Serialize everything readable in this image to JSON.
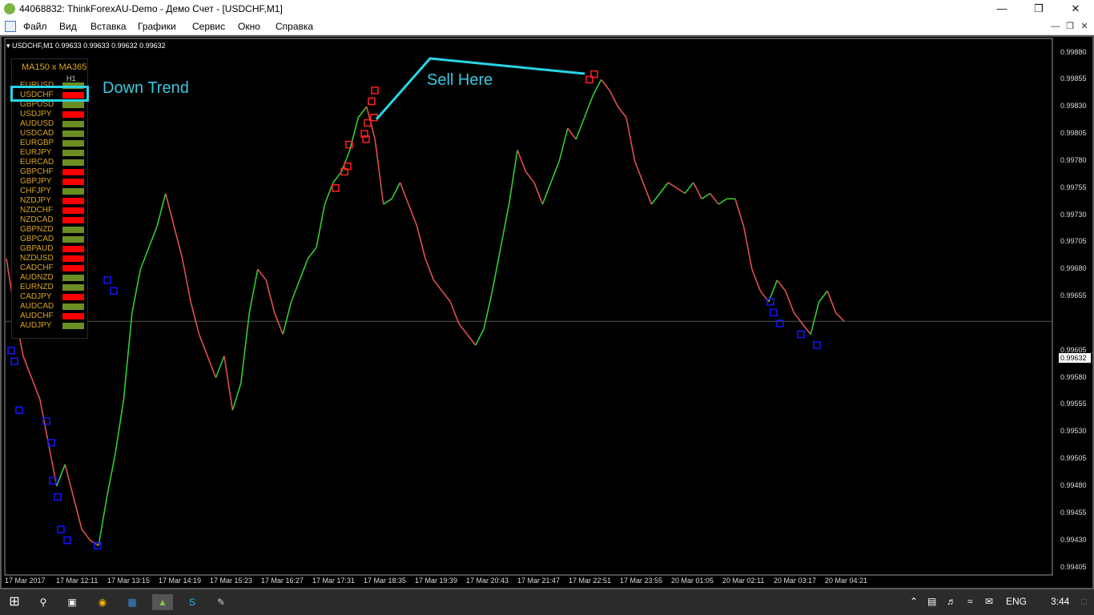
{
  "window": {
    "title": "44068832: ThinkForexAU-Demo - Демо Счет - [USDCHF,M1]"
  },
  "menu": [
    "Файл",
    "Вид",
    "Вставка",
    "Графики",
    "Сервис",
    "Окно",
    "Справка"
  ],
  "chart_header": "USDCHF,M1  0.99633 0.99633 0.99632 0.99632",
  "panel": {
    "title": "MA150  x  MA365",
    "timeframe": "H1",
    "rows": [
      {
        "pair": "EURUSD",
        "state": "green"
      },
      {
        "pair": "USDCHF",
        "state": "red"
      },
      {
        "pair": "GBPUSD",
        "state": "green"
      },
      {
        "pair": "USDJPY",
        "state": "red"
      },
      {
        "pair": "AUDUSD",
        "state": "green"
      },
      {
        "pair": "USDCAD",
        "state": "green"
      },
      {
        "pair": "EURGBP",
        "state": "green"
      },
      {
        "pair": "EURJPY",
        "state": "green"
      },
      {
        "pair": "EURCAD",
        "state": "green"
      },
      {
        "pair": "GBPCHF",
        "state": "red"
      },
      {
        "pair": "GBPJPY",
        "state": "red"
      },
      {
        "pair": "CHFJPY",
        "state": "green"
      },
      {
        "pair": "NZDJPY",
        "state": "red"
      },
      {
        "pair": "NZDCHF",
        "state": "red"
      },
      {
        "pair": "NZDCAD",
        "state": "red"
      },
      {
        "pair": "GBPNZD",
        "state": "green"
      },
      {
        "pair": "GBPCAD",
        "state": "green"
      },
      {
        "pair": "GBPAUD",
        "state": "red"
      },
      {
        "pair": "NZDUSD",
        "state": "red"
      },
      {
        "pair": "CADCHF",
        "state": "red"
      },
      {
        "pair": "AUDNZD",
        "state": "green"
      },
      {
        "pair": "EURNZD",
        "state": "green"
      },
      {
        "pair": "CADJPY",
        "state": "red"
      },
      {
        "pair": "AUDCAD",
        "state": "green"
      },
      {
        "pair": "AUDCHF",
        "state": "red"
      },
      {
        "pair": "AUDJPY",
        "state": "green"
      }
    ]
  },
  "annotations": {
    "down_trend": "Down Trend",
    "sell_here": "Sell Here"
  },
  "chart_data": {
    "type": "line",
    "symbol": "USDCHF",
    "timeframe": "M1",
    "y_ticks": [
      "0.99880",
      "0.99855",
      "0.99830",
      "0.99805",
      "0.99780",
      "0.99755",
      "0.99730",
      "0.99705",
      "0.99680",
      "0.99655",
      "0.99605",
      "0.99580",
      "0.99555",
      "0.99530",
      "0.99505",
      "0.99480",
      "0.99455",
      "0.99430",
      "0.99405"
    ],
    "ylim": [
      0.99398,
      0.9989
    ],
    "current_price": "0.99632",
    "x_ticks": [
      "17 Mar 2017",
      "17 Mar 12:11",
      "17 Mar 13:15",
      "17 Mar 14:19",
      "17 Mar 15:23",
      "17 Mar 16:27",
      "17 Mar 17:31",
      "17 Mar 18:35",
      "17 Mar 19:39",
      "17 Mar 20:43",
      "17 Mar 21:47",
      "17 Mar 22:51",
      "17 Mar 23:55",
      "20 Mar 01:05",
      "20 Mar 02:11",
      "20 Mar 03:17",
      "20 Mar 04:21"
    ],
    "series": [
      {
        "values": [
          0.9969,
          0.9964,
          0.996,
          0.9958,
          0.9956,
          0.9952,
          0.9948,
          0.995,
          0.9947,
          0.9944,
          0.9943,
          0.99425,
          0.9947,
          0.9951,
          0.9956,
          0.9964,
          0.9968,
          0.997,
          0.9972,
          0.9975,
          0.9972,
          0.9969,
          0.9965,
          0.9962,
          0.996,
          0.9958,
          0.996,
          0.9955,
          0.99575,
          0.9964,
          0.9968,
          0.9967,
          0.9964,
          0.9962,
          0.9965,
          0.9967,
          0.9969,
          0.997,
          0.9974,
          0.9976,
          0.9977,
          0.9979,
          0.9982,
          0.9983,
          0.998,
          0.9974,
          0.99745,
          0.9976,
          0.9974,
          0.9972,
          0.9969,
          0.9967,
          0.9966,
          0.9965,
          0.9963,
          0.9962,
          0.9961,
          0.99625,
          0.9966,
          0.997,
          0.9974,
          0.9979,
          0.9977,
          0.9976,
          0.9974,
          0.9976,
          0.9978,
          0.9981,
          0.998,
          0.9982,
          0.9984,
          0.99855,
          0.99845,
          0.9983,
          0.9982,
          0.9978,
          0.9976,
          0.9974,
          0.9975,
          0.9976,
          0.99755,
          0.9975,
          0.9976,
          0.99745,
          0.9975,
          0.9974,
          0.99745,
          0.99745,
          0.9972,
          0.9968,
          0.9966,
          0.9965,
          0.9967,
          0.9966,
          0.9964,
          0.9963,
          0.9962,
          0.9965,
          0.9966,
          0.9964,
          0.99632
        ]
      }
    ],
    "sell_markers": [
      0.99755,
      0.9977,
      0.99775,
      0.99795,
      0.998,
      0.99805,
      0.99815,
      0.9982,
      0.99835,
      0.99845,
      0.99855,
      0.9986
    ],
    "buy_markers": [
      0.99605,
      0.99595,
      0.9955,
      0.9954,
      0.9952,
      0.99485,
      0.9947,
      0.9944,
      0.9943,
      0.99425,
      0.9967,
      0.9966,
      0.9965,
      0.9964,
      0.9963,
      0.9962,
      0.9961
    ]
  },
  "taskbar": {
    "lang": "ENG",
    "time": "3:44"
  },
  "colors": {
    "bull": "#32cd32",
    "bear": "#e05050",
    "sell_marker": "#ff2020",
    "buy_marker": "#1515ff",
    "annotation": "#3cc9e0",
    "panel_green": "#6b8e23",
    "panel_red": "#ff0000"
  }
}
